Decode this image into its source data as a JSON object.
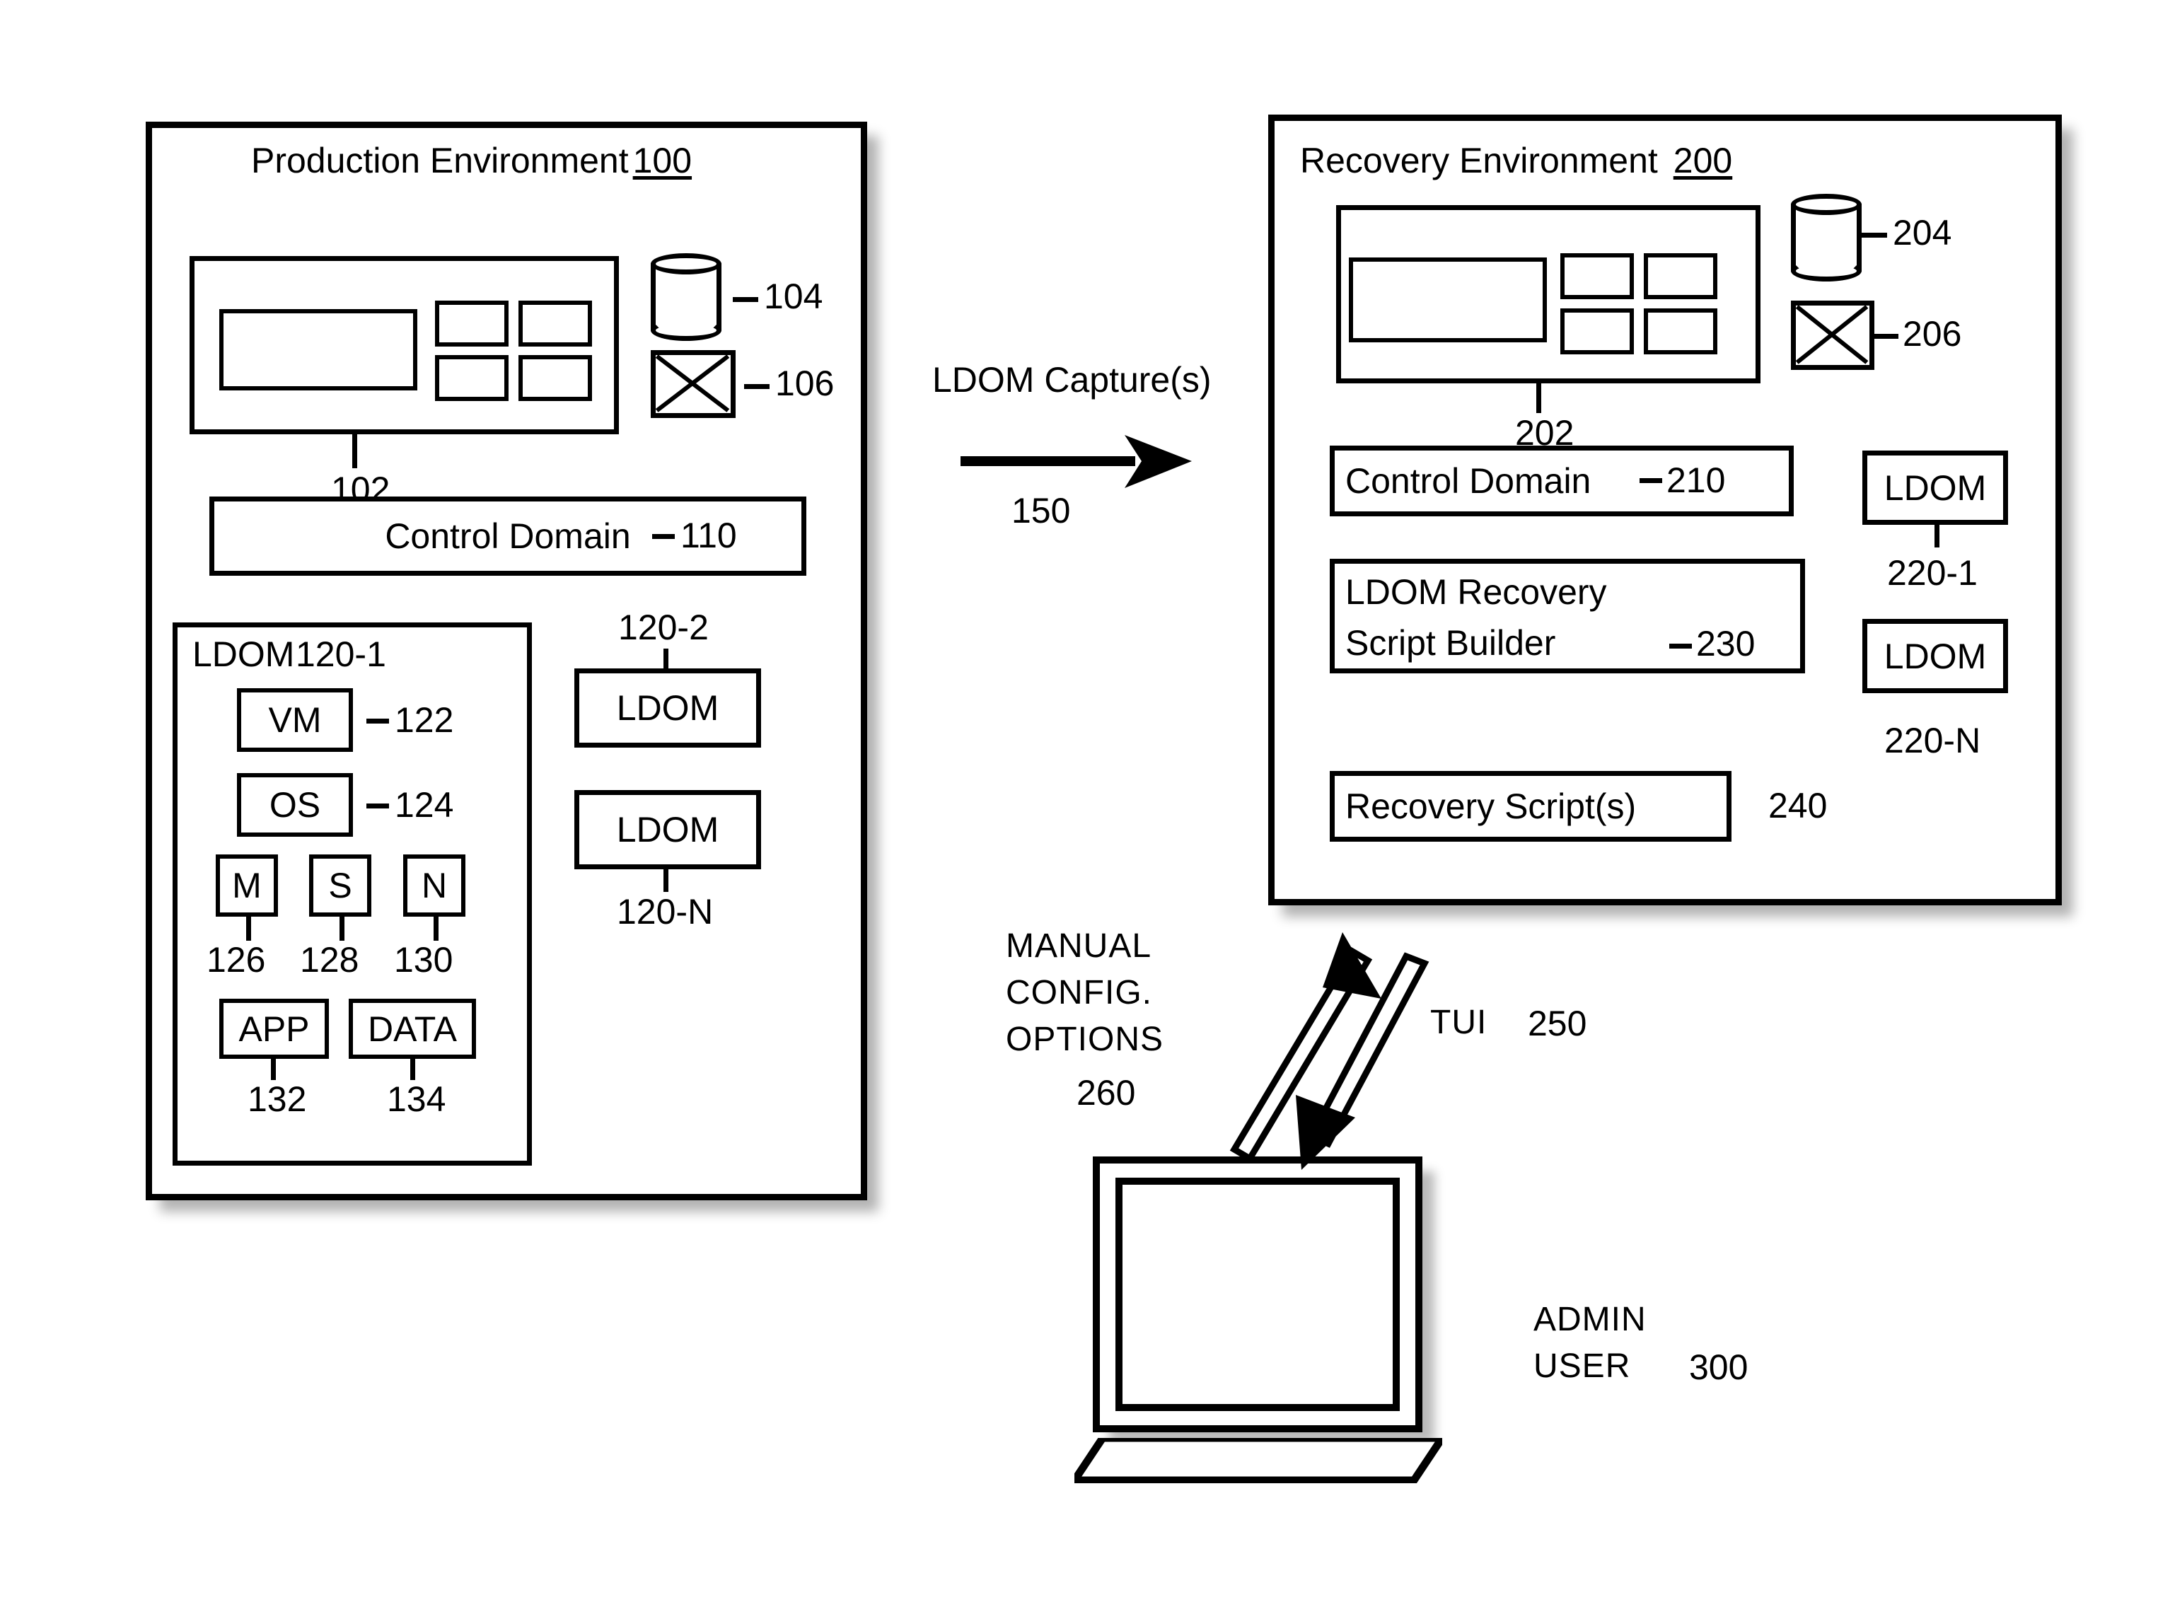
{
  "figure": {
    "production_env": {
      "title_text": "Production Environment",
      "title_ref": "100",
      "server": {
        "ref": "102"
      },
      "storage": {
        "icon": "cylinder-database-icon",
        "ref": "104"
      },
      "network": {
        "icon": "x-box-network-icon",
        "ref": "106"
      },
      "control_domain": {
        "label": "Control Domain",
        "ref": "110"
      },
      "ldom_primary": {
        "label": "LDOM",
        "ref": "120-1",
        "components": [
          {
            "label": "VM",
            "ref": "122"
          },
          {
            "label": "OS",
            "ref": "124"
          },
          {
            "label": "M",
            "ref": "126"
          },
          {
            "label": "S",
            "ref": "128"
          },
          {
            "label": "N",
            "ref": "130"
          },
          {
            "label": "APP",
            "ref": "132"
          },
          {
            "label": "DATA",
            "ref": "134"
          }
        ]
      },
      "ldom_others": [
        {
          "label": "LDOM",
          "ref": "120-2"
        },
        {
          "label": "LDOM",
          "ref": "120-N"
        }
      ]
    },
    "transfer": {
      "label": "LDOM Capture(s)",
      "ref": "150",
      "arrow": "right-arrow-icon"
    },
    "recovery_env": {
      "title_text": "Recovery Environment",
      "title_ref": "200",
      "server": {
        "ref": "202"
      },
      "storage": {
        "icon": "cylinder-database-icon",
        "ref": "204"
      },
      "network": {
        "icon": "x-box-network-icon",
        "ref": "206"
      },
      "control_domain": {
        "label": "Control Domain",
        "ref": "210"
      },
      "script_builder": {
        "line1": "LDOM Recovery",
        "line2": "Script Builder",
        "ref": "230"
      },
      "recovery_scripts": {
        "label": "Recovery Script(s)",
        "ref": "240"
      },
      "ldoms": [
        {
          "label": "LDOM",
          "ref": "220-1"
        },
        {
          "label": "LDOM",
          "ref": "220-N"
        }
      ]
    },
    "admin": {
      "manual_config": {
        "line1": "MANUAL",
        "line2": "CONFIG.",
        "line3": "OPTIONS",
        "ref": "260"
      },
      "tui": {
        "label": "TUI",
        "ref": "250"
      },
      "user": {
        "line1": "ADMIN",
        "line2": "USER",
        "ref": "300"
      },
      "device_icon": "laptop-icon"
    }
  }
}
